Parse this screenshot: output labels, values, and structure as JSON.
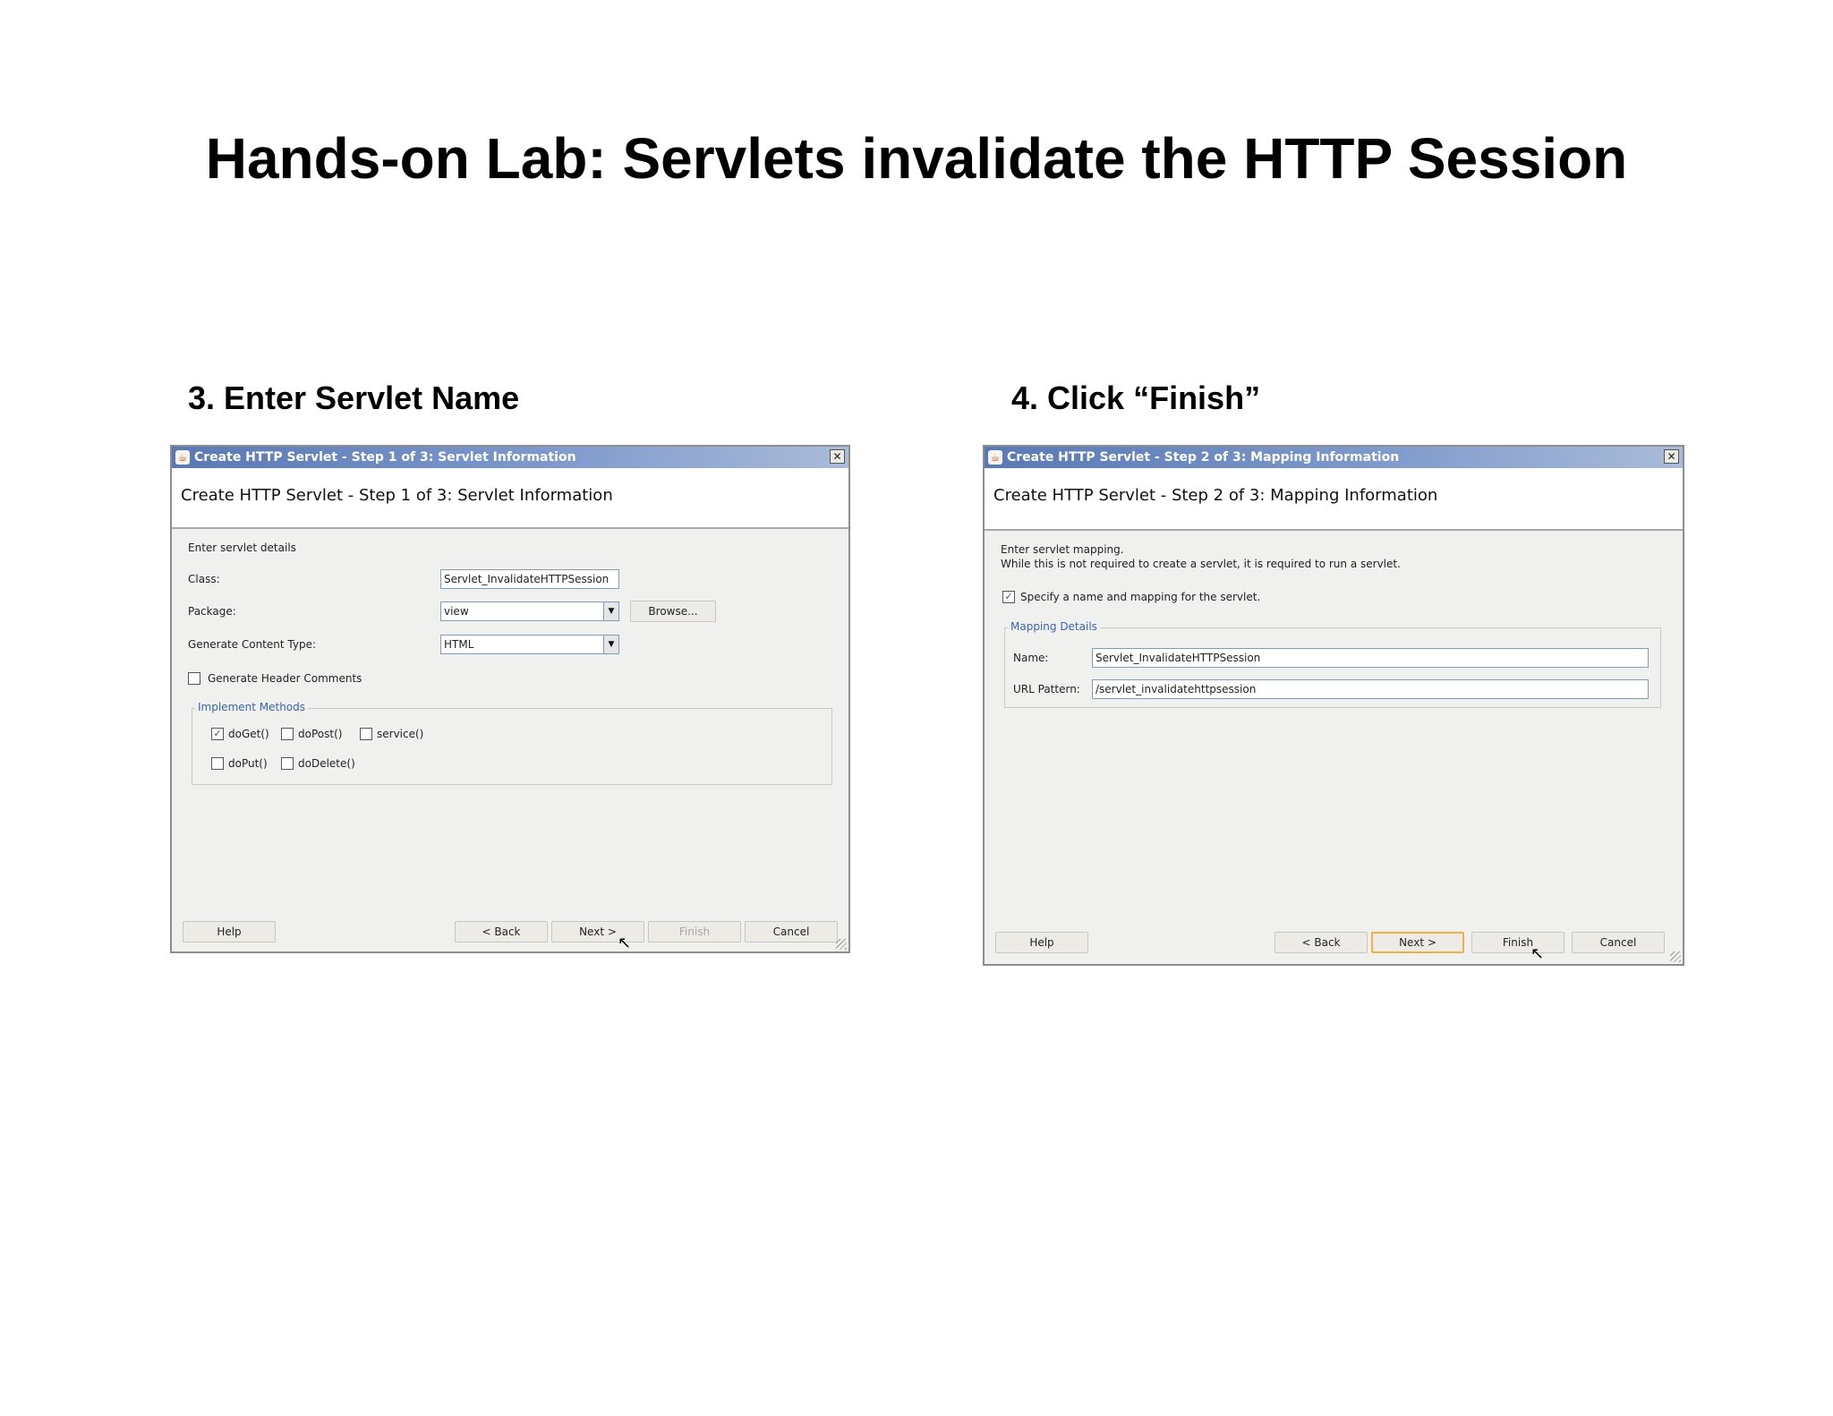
{
  "slide": {
    "title": "Hands-on Lab: Servlets invalidate the HTTP Session"
  },
  "steps": [
    {
      "caption": "3. Enter Servlet Name"
    },
    {
      "caption": "4. Click “Finish”"
    }
  ],
  "dialog1": {
    "titlebar": "Create HTTP Servlet - Step 1 of 3: Servlet Information",
    "close_label": "✕",
    "header": "Create HTTP Servlet - Step 1 of 3: Servlet Information",
    "intro": "Enter servlet details",
    "class_label": "Class:",
    "class_value": "Servlet_InvalidateHTTPSession",
    "package_label": "Package:",
    "package_value": "view",
    "browse_label": "Browse...",
    "content_type_label": "Generate Content Type:",
    "content_type_value": "HTML",
    "header_comments_label": "Generate Header Comments",
    "header_comments_checked": false,
    "methods_legend": "Implement Methods",
    "methods": [
      {
        "label": "doGet()",
        "checked": true
      },
      {
        "label": "doPost()",
        "checked": false
      },
      {
        "label": "service()",
        "checked": false
      },
      {
        "label": "doPut()",
        "checked": false
      },
      {
        "label": "doDelete()",
        "checked": false
      }
    ],
    "buttons": {
      "help": "Help",
      "back": "< Back",
      "next": "Next >",
      "finish": "Finish",
      "cancel": "Cancel"
    }
  },
  "dialog2": {
    "titlebar": "Create HTTP Servlet - Step 2 of 3: Mapping Information",
    "close_label": "✕",
    "header": "Create HTTP Servlet - Step 2 of 3: Mapping Information",
    "intro_line1": "Enter servlet mapping.",
    "intro_line2": "While this is not required to create a servlet, it is required to run a servlet.",
    "specify_label": "Specify a name and mapping for the servlet.",
    "specify_checked": true,
    "mapping_legend": "Mapping Details",
    "name_label": "Name:",
    "name_value": "Servlet_InvalidateHTTPSession",
    "url_label": "URL Pattern:",
    "url_value": "/servlet_invalidatehttpsession",
    "buttons": {
      "help": "Help",
      "back": "< Back",
      "next": "Next >",
      "finish": "Finish",
      "cancel": "Cancel"
    }
  },
  "icons": {
    "app_icon": "java-cup-icon",
    "check_mark": "✓",
    "dropdown_arrow": "▼",
    "cursor": "mouse-pointer-icon"
  }
}
